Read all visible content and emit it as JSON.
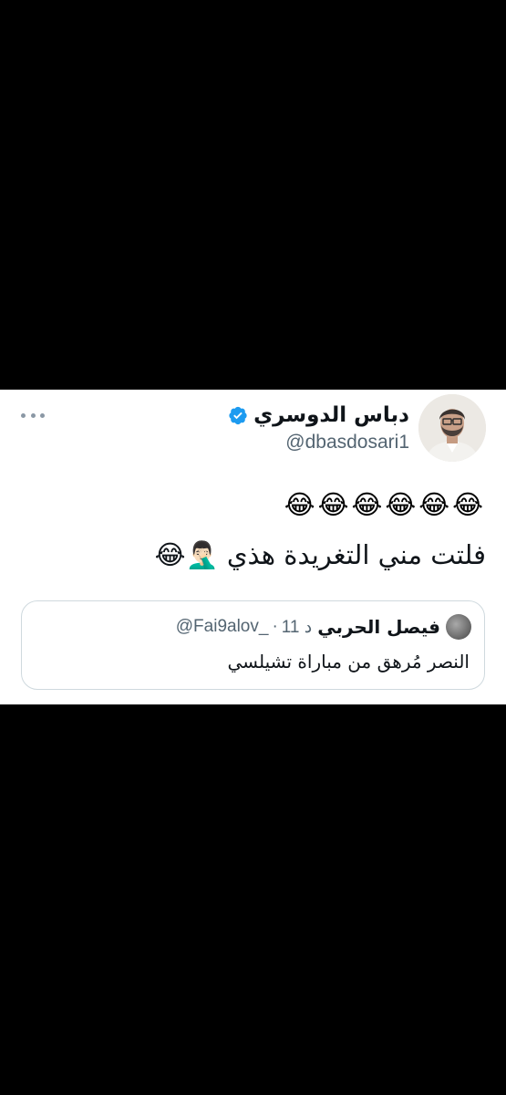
{
  "tweet": {
    "author": {
      "display_name": "دباس الدوسري",
      "handle": "@dbasdosari1",
      "verified": true,
      "avatar_icon": "profile-photo"
    },
    "more_icon": "more-dots-icon",
    "emoji_line": "😂😂😂😂😂😂",
    "text": "فلتت مني التغريدة هذي 🤦🏻‍♂️😂"
  },
  "quoted_tweet": {
    "author": {
      "display_name": "فيصل الحربي",
      "handle": "@Fai9alov_",
      "avatar_icon": "profile-photo"
    },
    "separator": "·",
    "time": "11 د",
    "text": "النصر مُرهق من مباراة تشيلسي"
  },
  "colors": {
    "background": "#000000",
    "card": "#ffffff",
    "verified_blue": "#1d9bf0",
    "secondary_text": "#536471",
    "border": "#cfd9de"
  }
}
